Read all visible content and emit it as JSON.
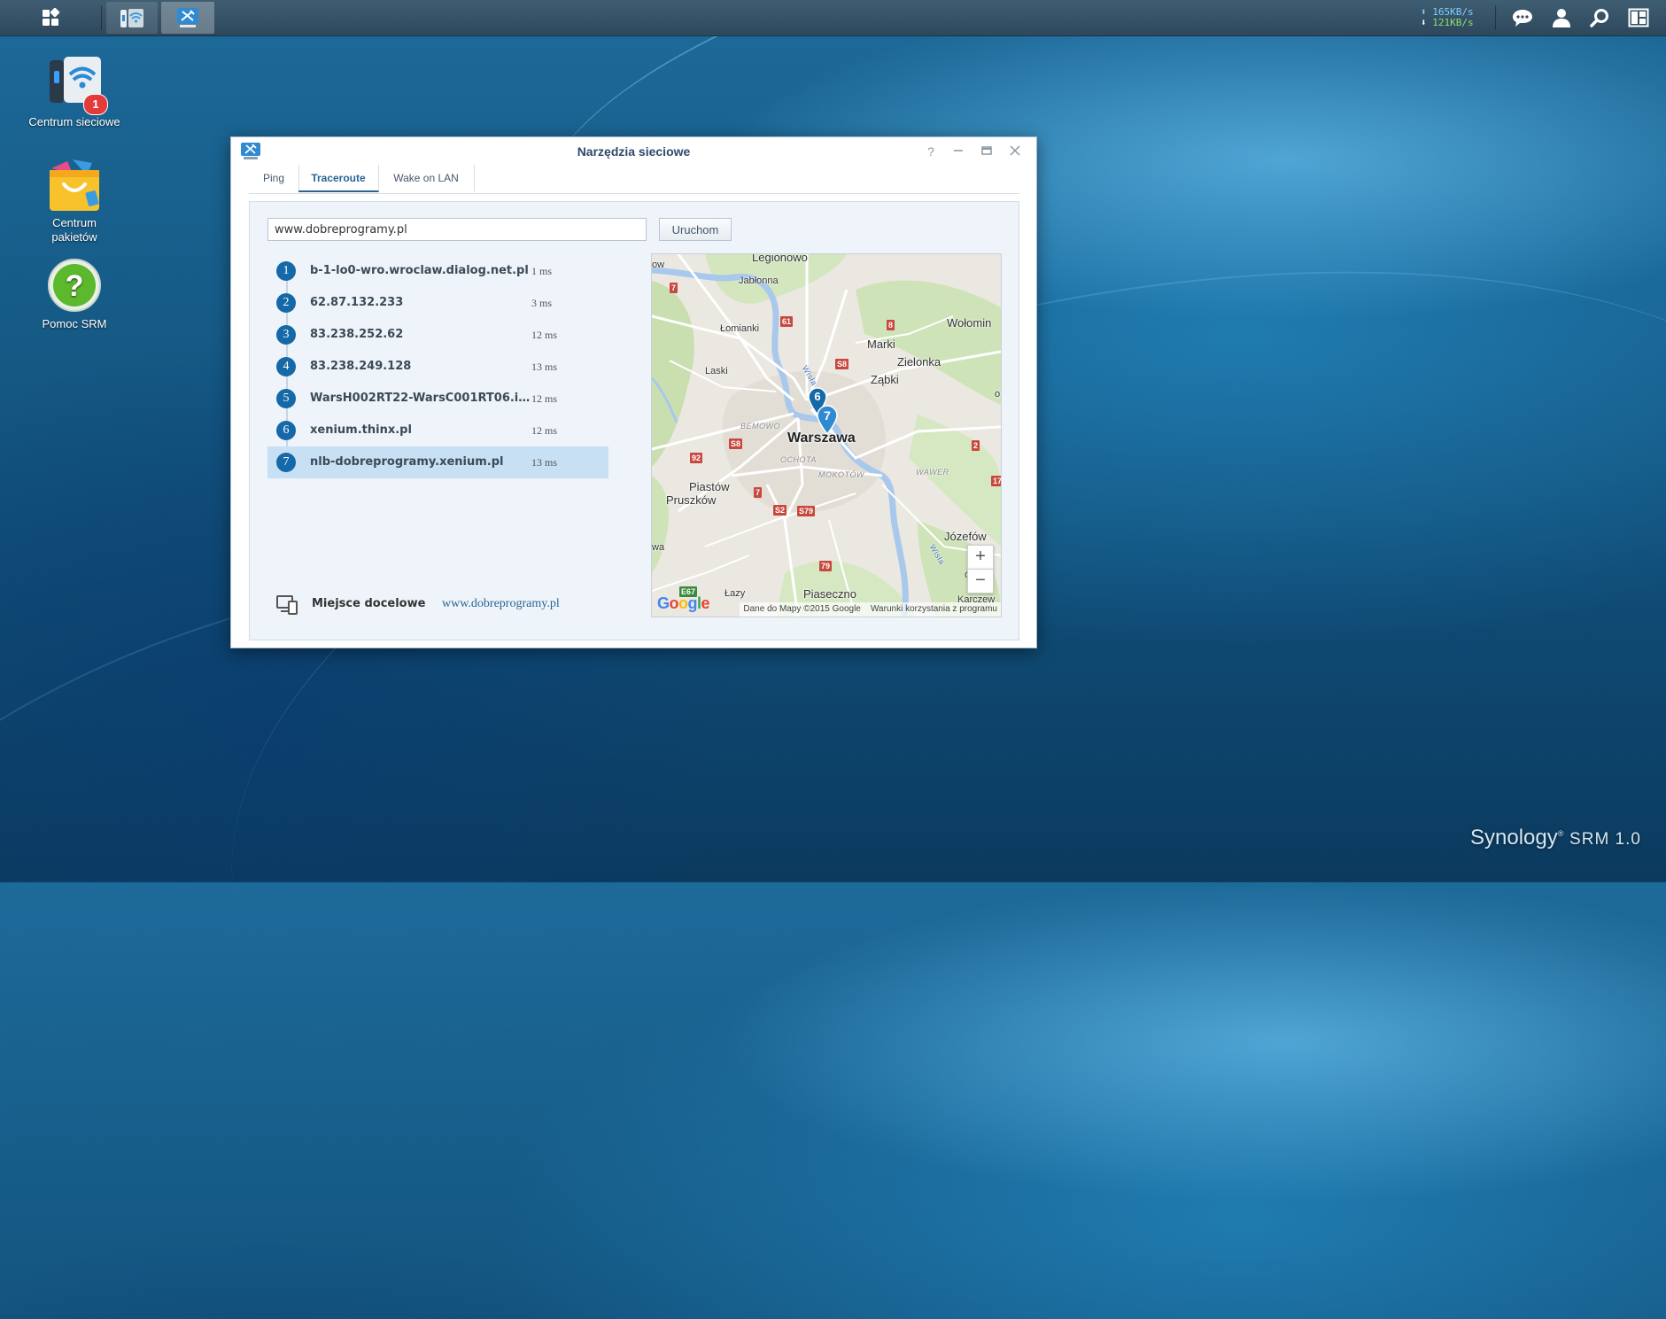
{
  "taskbar": {
    "main_menu_icon": "grid-icon",
    "apps": [
      {
        "name": "Centrum sieciowe",
        "icon": "wifi-router-icon"
      },
      {
        "name": "Narzędzia sieciowe",
        "icon": "network-tools-icon"
      }
    ],
    "speed": {
      "upload": "165KB/s",
      "download": "121KB/s"
    },
    "tray": [
      "chat-icon",
      "user-icon",
      "search-icon",
      "widgets-icon"
    ]
  },
  "desktop": {
    "icons": [
      {
        "label": "Centrum sieciowe",
        "badge": "1",
        "icon": "wifi-router-icon"
      },
      {
        "label": "Centrum pakietów",
        "icon": "package-bag-icon"
      },
      {
        "label": "Pomoc SRM",
        "icon": "help-icon"
      }
    ]
  },
  "window": {
    "title": "Narzędzia sieciowe",
    "controls": [
      "help-icon",
      "minimize-icon",
      "maximize-icon",
      "close-icon"
    ],
    "tabs": [
      {
        "label": "Ping",
        "active": false
      },
      {
        "label": "Traceroute",
        "active": true
      },
      {
        "label": "Wake on LAN",
        "active": false
      }
    ],
    "target_input": {
      "value": "www.dobreprogramy.pl"
    },
    "run_label": "Uruchom",
    "hops": [
      {
        "n": "1",
        "host": "b-1-lo0-wro.wroclaw.dialog.net.pl",
        "time": "1 ms"
      },
      {
        "n": "2",
        "host": "62.87.132.233",
        "time": "3 ms"
      },
      {
        "n": "3",
        "host": "83.238.252.62",
        "time": "12 ms"
      },
      {
        "n": "4",
        "host": "83.238.249.128",
        "time": "13 ms"
      },
      {
        "n": "5",
        "host": "WarsH002RT22-WarsC001RT06.in...",
        "time": "12 ms"
      },
      {
        "n": "6",
        "host": "xenium.thinx.pl",
        "time": "12 ms"
      },
      {
        "n": "7",
        "host": "nlb-dobreprogramy.xenium.pl",
        "time": "13 ms",
        "selected": true
      }
    ],
    "destination": {
      "label": "Miejsce docelowe",
      "value": "www.dobreprogramy.pl"
    },
    "map": {
      "places": [
        "Legionowo",
        "Jabłonna",
        "Łomianki",
        "Wołomin",
        "Marki",
        "Zielonka",
        "Ząbki",
        "Laski",
        "Warszawa",
        "Piastów",
        "Pruszków",
        "Józefów",
        "Piaseczno",
        "Łazy",
        "Karczew"
      ],
      "districts": [
        "BEMOWO",
        "OCHOTA",
        "MOKOTÓW",
        "WAWER"
      ],
      "river": "Wisła",
      "roads": [
        "7",
        "61",
        "8",
        "S8",
        "S8",
        "92",
        "7",
        "S2",
        "S79",
        "79",
        "E67",
        "2",
        "17"
      ],
      "edge_labels": [
        "ow",
        "o",
        "wa",
        "ó"
      ],
      "markers": [
        "6",
        "7"
      ],
      "zoom_in": "+",
      "zoom_out": "−",
      "logo": "Google",
      "attribution": "Dane do Mapy ©2015 Google",
      "terms": "Warunki korzystania z programu"
    }
  },
  "branding": {
    "name": "Synology",
    "product": "SRM 1.0"
  }
}
